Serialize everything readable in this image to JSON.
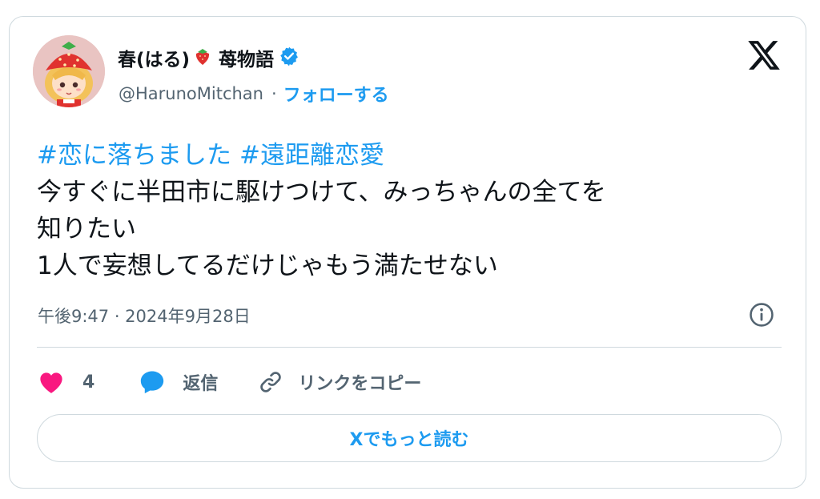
{
  "author": {
    "display_name": "春(はる)",
    "name_emoji": "strawberry-emoji",
    "name_suffix": "苺物語",
    "verified": true,
    "handle": "@HarunoMitchan",
    "separator": "·",
    "follow_label": "フォローする",
    "avatar": "strawberry-hat-girl-avatar"
  },
  "platform_icon": "x-logo-icon",
  "tweet": {
    "hashtags": [
      "#恋に落ちました",
      "#遠距離恋愛"
    ],
    "lines": [
      "今すぐに半田市に駆けつけて、みっちゃんの全てを",
      "知りたい",
      "1人で妄想してるだけじゃもう満たせない"
    ],
    "timestamp": "午後9:47 · 2024年9月28日"
  },
  "actions": {
    "like_count": "4",
    "reply_label": "返信",
    "copy_link_label": "リンクをコピー"
  },
  "read_more_label": "Xでもっと読む",
  "colors": {
    "accent": "#1d9bf0",
    "like": "#f91880",
    "secondary_text": "#536471",
    "border": "#cfd9de"
  }
}
